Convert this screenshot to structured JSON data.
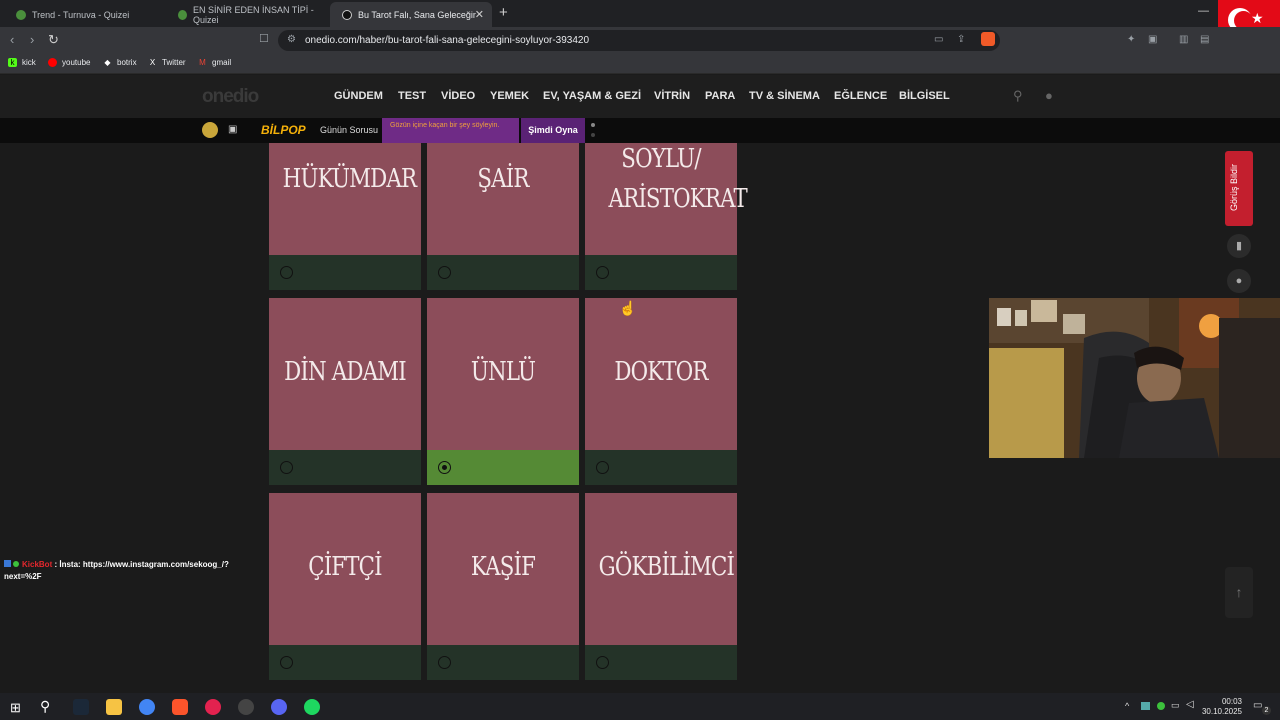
{
  "browser": {
    "tabs": [
      {
        "title": "Trend - Turnuva - Quizei",
        "active": false
      },
      {
        "title": "EN SİNİR EDEN İNSAN TİPİ - Quizei",
        "active": false
      },
      {
        "title": "Bu Tarot Falı, Sana Geleceğini Söy",
        "active": true
      }
    ],
    "url": "onedio.com/haber/bu-tarot-fali-sana-gelecegini-soyluyor-393420",
    "bookmarks": [
      "kick",
      "youtube",
      "botrix",
      "Twitter",
      "gmail"
    ]
  },
  "site": {
    "logo": "onedio",
    "nav": [
      "GÜNDEM",
      "TEST",
      "VİDEO",
      "YEMEK",
      "EV, YAŞAM & GEZİ",
      "VİTRİN",
      "PARA",
      "TV & SİNEMA",
      "EĞLENCE",
      "BİLGİSEL"
    ],
    "bilpop": {
      "brand": "BİLPOP",
      "label": "Günün Sorusu",
      "question": "Gözün içine kaçan bir şey söyleyin.",
      "cta": "Şimdi Oyna"
    },
    "feedback": "Görüş Bildir"
  },
  "quiz": {
    "options": [
      {
        "label": "HÜKÜMDAR",
        "selected": false
      },
      {
        "label": "ŞAİR",
        "selected": false
      },
      {
        "label": "SOYLU/ ARİSTOKRAT",
        "selected": false
      },
      {
        "label": "DİN ADAMI",
        "selected": false
      },
      {
        "label": "ÜNLÜ",
        "selected": true
      },
      {
        "label": "DOKTOR",
        "selected": false
      },
      {
        "label": "ÇİFTÇİ",
        "selected": false
      },
      {
        "label": "KAŞİF",
        "selected": false
      },
      {
        "label": "GÖKBİLİMCİ",
        "selected": false
      }
    ]
  },
  "chat": {
    "user": "KickBot",
    "message": ": İnsta: https://www.instagram.com/sekoog_/?next=%2F"
  },
  "taskbar": {
    "time": "00:03",
    "date": "30.10.2025",
    "notifications": "2"
  },
  "colors": {
    "card": "#8c4d5a",
    "radio_row": "#243328",
    "radio_selected": "#558a35",
    "feedback": "#c31f2e"
  }
}
